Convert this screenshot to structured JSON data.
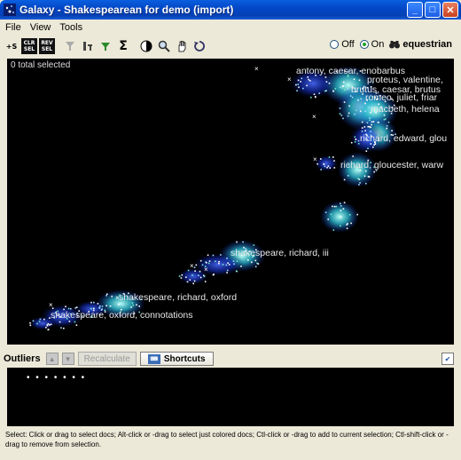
{
  "window": {
    "title": "Galaxy - Shakespearean for demo (import)",
    "controls": [
      "minimize",
      "maximize",
      "close"
    ]
  },
  "menu": [
    "File",
    "View",
    "Tools"
  ],
  "toolbar": {
    "buttons": [
      {
        "name": "add-selection-button",
        "label": "+S",
        "icon": "add-selection-icon"
      },
      {
        "name": "clear-selection-button",
        "label": "CLR SEL",
        "icon": "clear-selection-icon"
      },
      {
        "name": "reverse-selection-button",
        "label": "REV SEL",
        "icon": "reverse-selection-icon"
      },
      {
        "name": "filter-button",
        "label": "",
        "icon": "filter-icon"
      },
      {
        "name": "tools-button",
        "label": "",
        "icon": "tools-icon"
      },
      {
        "name": "funnel-button",
        "label": "",
        "icon": "funnel-icon"
      },
      {
        "name": "sum-button",
        "label": "Σ",
        "icon": "sigma-icon"
      },
      {
        "name": "contrast-button",
        "label": "",
        "icon": "contrast-icon"
      },
      {
        "name": "zoom-button",
        "label": "",
        "icon": "magnifier-icon"
      },
      {
        "name": "pan-button",
        "label": "",
        "icon": "hand-icon"
      },
      {
        "name": "reset-button",
        "label": "",
        "icon": "reset-icon"
      }
    ],
    "radio": {
      "off_label": "Off",
      "on_label": "On",
      "selected": "On"
    },
    "search_term": "equestrian"
  },
  "galaxy": {
    "selected_text": "0 total selected",
    "cluster_labels": [
      "antony, caesar, enobarbus",
      "proteus, valentine,",
      "brutus, caesar, brutus",
      "romeo, juliet, friar",
      "macbeth, helena",
      "richard, edward, glou",
      "richard, gloucester, warw",
      "shakespeare, richard, iii",
      "shakespeare, richard, oxford",
      "shakespeare, oxford, connotations"
    ]
  },
  "outliers": {
    "label": "Outliers",
    "recalculate_label": "Recalculate",
    "shortcuts_label": "Shortcuts",
    "dots": "• • • • • • •"
  },
  "status": {
    "text": "Select: Click or drag to select docs; Alt-click or -drag to select just colored docs; Ctl-click or -drag to add to current selection; Ctl-shift-click or -drag to remove from selection."
  },
  "colors": {
    "title_bar": "#0348c7",
    "galaxy_bg": "#000000",
    "cluster_glow": "#1530c8",
    "hot_spot": "#5ef0e0"
  }
}
